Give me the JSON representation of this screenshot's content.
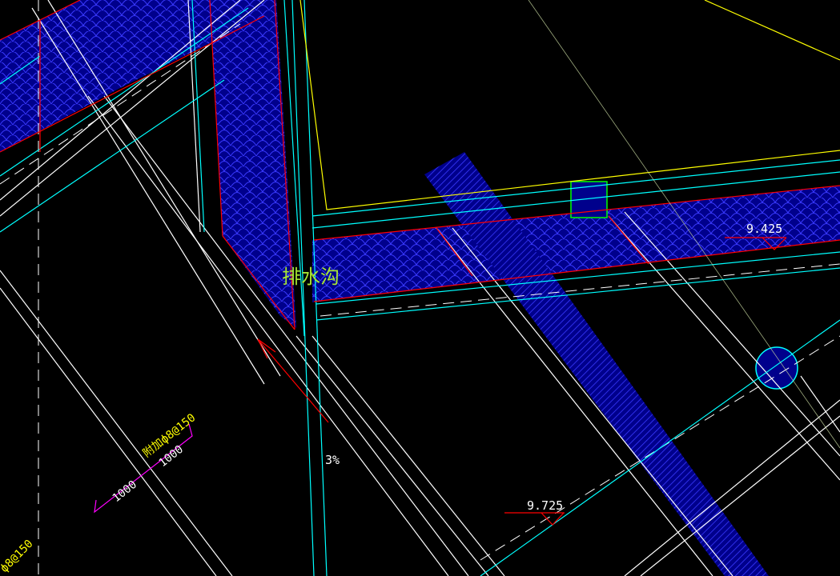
{
  "drawing": {
    "channel_label": "排水沟",
    "elevations": [
      "9.425",
      "9.725"
    ],
    "slope": "3%",
    "rebar_labels": [
      "附加ф8@150",
      "1000",
      "1000",
      "ф8@150"
    ]
  },
  "colors": {
    "background": "#000000",
    "cyan": "#00ffff",
    "white": "#ffffff",
    "yellow": "#ffff00",
    "red": "#ff0000",
    "blue_fill": "#00008c",
    "blue_hatch": "#3a3aff",
    "magenta": "#ff00ff",
    "green": "#00ff00",
    "label_green": "#a8e632"
  }
}
